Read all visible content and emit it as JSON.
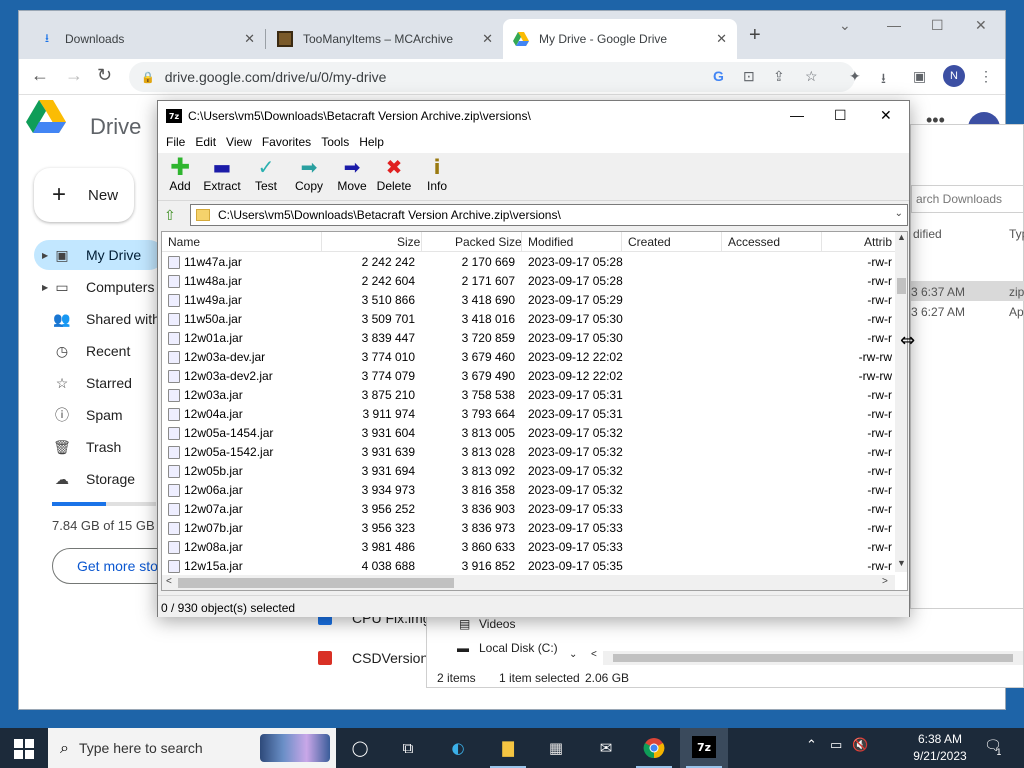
{
  "browser": {
    "tabs": [
      {
        "title": "Downloads",
        "close": "✕"
      },
      {
        "title": "TooManyItems – MCArchive",
        "close": "✕"
      },
      {
        "title": "My Drive - Google Drive",
        "close": "✕"
      }
    ],
    "new_tab": "+",
    "url": "drive.google.com/drive/u/0/my-drive",
    "profile_initial": "N"
  },
  "drive": {
    "title": "Drive",
    "new_label": "New",
    "nav": [
      {
        "label": "My Drive"
      },
      {
        "label": "Computers"
      },
      {
        "label": "Shared with"
      },
      {
        "label": "Recent"
      },
      {
        "label": "Starred"
      },
      {
        "label": "Spam"
      },
      {
        "label": "Trash"
      },
      {
        "label": "Storage"
      }
    ],
    "storage_text": "7.84 GB of 15 GB",
    "storage_fraction": 0.52,
    "get_more": "Get more sto",
    "files": [
      "CPU Fix.img",
      "CSDVersion"
    ]
  },
  "explorer": {
    "search_placeholder": "arch Downloads",
    "col_modified": "dified",
    "col_type": "Typ",
    "rows": [
      {
        "date": "3 6:37 AM",
        "type": "zip"
      },
      {
        "date": "3 6:27 AM",
        "type": "Ap"
      }
    ],
    "tree": [
      "Videos",
      "Local Disk (C:)"
    ],
    "status_items": "2 items",
    "status_selected": "1 item selected",
    "status_size": "2.06 GB"
  },
  "zip": {
    "icon_text": "7z",
    "title": "C:\\Users\\vm5\\Downloads\\Betacraft Version Archive.zip\\versions\\",
    "menu": [
      "File",
      "Edit",
      "View",
      "Favorites",
      "Tools",
      "Help"
    ],
    "toolbar": [
      "Add",
      "Extract",
      "Test",
      "Copy",
      "Move",
      "Delete",
      "Info"
    ],
    "path": "C:\\Users\\vm5\\Downloads\\Betacraft Version Archive.zip\\versions\\",
    "columns": [
      "Name",
      "Size",
      "Packed Size",
      "Modified",
      "Created",
      "Accessed",
      "Attrib"
    ],
    "rows": [
      [
        "11w47a.jar",
        "2 242 242",
        "2 170 669",
        "2023-09-17 05:28",
        "-rw-r"
      ],
      [
        "11w48a.jar",
        "2 242 604",
        "2 171 607",
        "2023-09-17 05:28",
        "-rw-r"
      ],
      [
        "11w49a.jar",
        "3 510 866",
        "3 418 690",
        "2023-09-17 05:29",
        "-rw-r"
      ],
      [
        "11w50a.jar",
        "3 509 701",
        "3 418 016",
        "2023-09-17 05:30",
        "-rw-r"
      ],
      [
        "12w01a.jar",
        "3 839 447",
        "3 720 859",
        "2023-09-17 05:30",
        "-rw-r"
      ],
      [
        "12w03a-dev.jar",
        "3 774 010",
        "3 679 460",
        "2023-09-12 22:02",
        "-rw-rw"
      ],
      [
        "12w03a-dev2.jar",
        "3 774 079",
        "3 679 490",
        "2023-09-12 22:02",
        "-rw-rw"
      ],
      [
        "12w03a.jar",
        "3 875 210",
        "3 758 538",
        "2023-09-17 05:31",
        "-rw-r"
      ],
      [
        "12w04a.jar",
        "3 911 974",
        "3 793 664",
        "2023-09-17 05:31",
        "-rw-r"
      ],
      [
        "12w05a-1454.jar",
        "3 931 604",
        "3 813 005",
        "2023-09-17 05:32",
        "-rw-r"
      ],
      [
        "12w05a-1542.jar",
        "3 931 639",
        "3 813 028",
        "2023-09-17 05:32",
        "-rw-r"
      ],
      [
        "12w05b.jar",
        "3 931 694",
        "3 813 092",
        "2023-09-17 05:32",
        "-rw-r"
      ],
      [
        "12w06a.jar",
        "3 934 973",
        "3 816 358",
        "2023-09-17 05:32",
        "-rw-r"
      ],
      [
        "12w07a.jar",
        "3 956 252",
        "3 836 903",
        "2023-09-17 05:33",
        "-rw-r"
      ],
      [
        "12w07b.jar",
        "3 956 323",
        "3 836 973",
        "2023-09-17 05:33",
        "-rw-r"
      ],
      [
        "12w08a.jar",
        "3 981 486",
        "3 860 633",
        "2023-09-17 05:33",
        "-rw-r"
      ],
      [
        "12w15a.jar",
        "4 038 688",
        "3 916 852",
        "2023-09-17 05:35",
        "-rw-r"
      ]
    ],
    "status": "0 / 930 object(s) selected"
  },
  "taskbar": {
    "search_text": "Type here to search",
    "time": "6:38 AM",
    "date": "9/21/2023",
    "notification_count": "1"
  },
  "colors": {
    "accent": "#1a73e8",
    "active_nav": "#c2e7ff",
    "taskbar": "#1c2a3a"
  }
}
